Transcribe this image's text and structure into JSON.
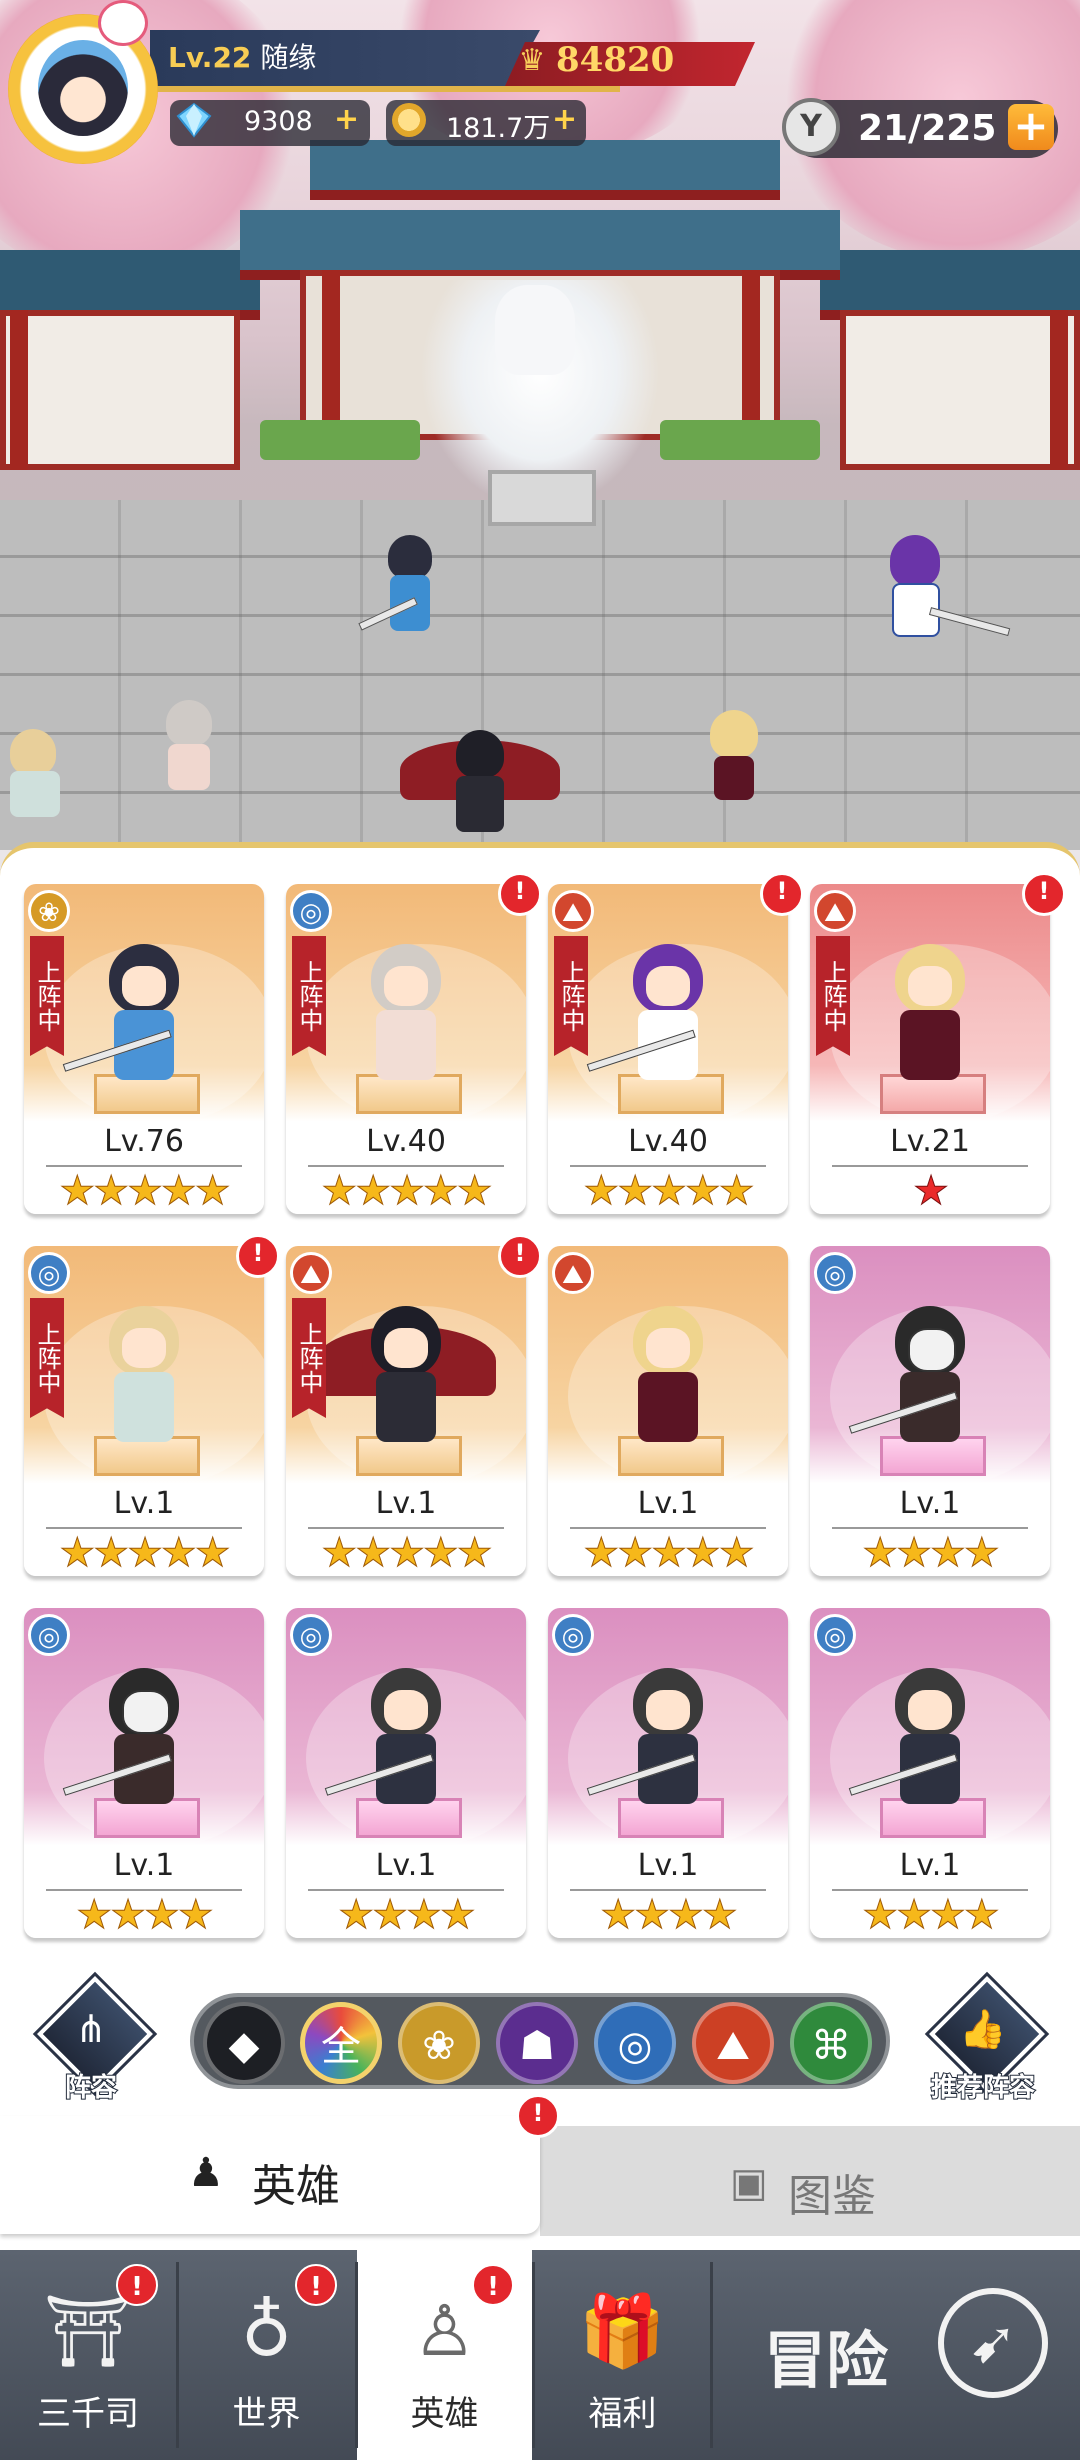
{
  "player": {
    "level": "Lv.22",
    "name": "随缘",
    "power": "84820",
    "diamonds": "9308",
    "gold": "181.7万",
    "stamina": "21/225"
  },
  "heroes": [
    {
      "level": "Lv.76",
      "stars": "★★★★★",
      "faction": "lotus",
      "on_team": true,
      "alert": false,
      "rarity": "gold"
    },
    {
      "level": "Lv.40",
      "stars": "★★★★★",
      "faction": "yin",
      "on_team": true,
      "alert": true,
      "rarity": "gold"
    },
    {
      "level": "Lv.40",
      "stars": "★★★★★",
      "faction": "monk",
      "on_team": true,
      "alert": true,
      "rarity": "gold"
    },
    {
      "level": "Lv.21",
      "stars": "★",
      "faction": "monk",
      "on_team": true,
      "alert": true,
      "rarity": "red"
    },
    {
      "level": "Lv.1",
      "stars": "★★★★★",
      "faction": "yin",
      "on_team": true,
      "alert": true,
      "rarity": "gold"
    },
    {
      "level": "Lv.1",
      "stars": "★★★★★",
      "faction": "monk",
      "on_team": true,
      "alert": true,
      "rarity": "gold"
    },
    {
      "level": "Lv.1",
      "stars": "★★★★★",
      "faction": "monk",
      "on_team": false,
      "alert": false,
      "rarity": "gold"
    },
    {
      "level": "Lv.1",
      "stars": "★★★★",
      "faction": "yin",
      "on_team": false,
      "alert": false,
      "rarity": "purple"
    },
    {
      "level": "Lv.1",
      "stars": "★★★★",
      "faction": "yin",
      "on_team": false,
      "alert": false,
      "rarity": "purple"
    },
    {
      "level": "Lv.1",
      "stars": "★★★★",
      "faction": "yin",
      "on_team": false,
      "alert": false,
      "rarity": "purple"
    },
    {
      "level": "Lv.1",
      "stars": "★★★★",
      "faction": "yin",
      "on_team": false,
      "alert": false,
      "rarity": "purple"
    },
    {
      "level": "Lv.1",
      "stars": "★★★★",
      "faction": "yin",
      "on_team": false,
      "alert": false,
      "rarity": "purple"
    }
  ],
  "badges": {
    "on_team": "上阵中",
    "alert": "!"
  },
  "filters": {
    "formation_label": "阵容",
    "recommend_label": "推荐阵容",
    "all_label": "全"
  },
  "tabs": {
    "hero": "英雄",
    "codex": "图鉴"
  },
  "nav": [
    {
      "label": "三千司",
      "alert": true
    },
    {
      "label": "世界",
      "alert": true
    },
    {
      "label": "英雄",
      "alert": true,
      "active": true
    },
    {
      "label": "福利",
      "alert": false
    }
  ],
  "adventure": "冒险"
}
